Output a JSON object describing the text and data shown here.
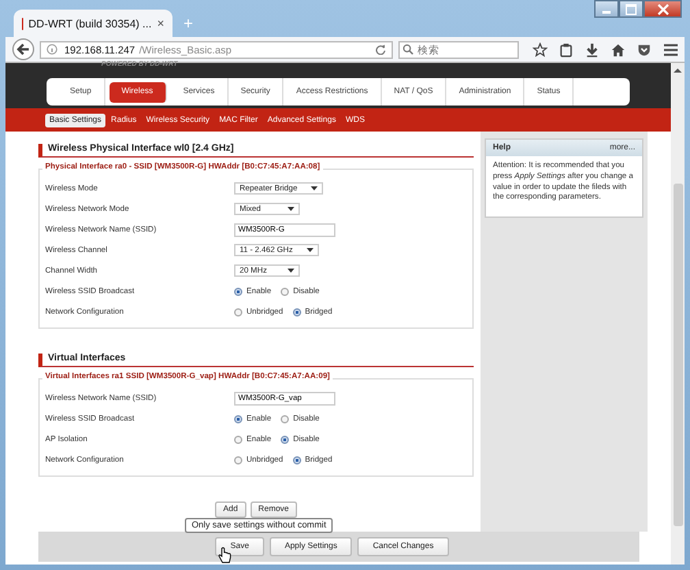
{
  "window": {
    "tab_title": "DD-WRT (build 30354) ...",
    "tab_close": "×",
    "new_tab": "+"
  },
  "address_bar": {
    "host": "192.168.11.247",
    "path": "/Wireless_Basic.asp"
  },
  "search": {
    "placeholder": "検索"
  },
  "branding": "POWERED BY DD-WRT",
  "nav": [
    {
      "label": "Setup",
      "selected": false
    },
    {
      "label": "Wireless",
      "selected": true
    },
    {
      "label": "Services",
      "selected": false
    },
    {
      "label": "Security",
      "selected": false
    },
    {
      "label": "Access Restrictions",
      "selected": false
    },
    {
      "label": "NAT / QoS",
      "selected": false
    },
    {
      "label": "Administration",
      "selected": false
    },
    {
      "label": "Status",
      "selected": false
    }
  ],
  "subnav": [
    {
      "label": "Basic Settings",
      "selected": true
    },
    {
      "label": "Radius",
      "selected": false
    },
    {
      "label": "Wireless Security",
      "selected": false
    },
    {
      "label": "MAC Filter",
      "selected": false
    },
    {
      "label": "Advanced Settings",
      "selected": false
    },
    {
      "label": "WDS",
      "selected": false
    }
  ],
  "sections": [
    {
      "title": "Wireless Physical Interface wl0 [2.4 GHz]",
      "legend": "Physical Interface ra0 - SSID [WM3500R-G] HWAddr [B0:C7:45:A7:AA:08]",
      "rows": [
        {
          "label": "Wireless Mode",
          "kind": "select",
          "value": "Repeater Bridge"
        },
        {
          "label": "Wireless Network Mode",
          "kind": "select",
          "value": "Mixed"
        },
        {
          "label": "Wireless Network Name (SSID)",
          "kind": "text",
          "value": "WM3500R-G"
        },
        {
          "label": "Wireless Channel",
          "kind": "select",
          "value": "11 - 2.462 GHz"
        },
        {
          "label": "Channel Width",
          "kind": "select",
          "value": "20 MHz"
        },
        {
          "label": "Wireless SSID Broadcast",
          "kind": "radio",
          "options": [
            {
              "label": "Enable",
              "selected": true
            },
            {
              "label": "Disable",
              "selected": false
            }
          ]
        },
        {
          "label": "Network Configuration",
          "kind": "radio",
          "options": [
            {
              "label": "Unbridged",
              "selected": false
            },
            {
              "label": "Bridged",
              "selected": true
            }
          ]
        }
      ]
    },
    {
      "title": "Virtual Interfaces",
      "legend": "Virtual Interfaces ra1 SSID [WM3500R-G_vap] HWAddr [B0:C7:45:A7:AA:09]",
      "rows": [
        {
          "label": "Wireless Network Name (SSID)",
          "kind": "text",
          "value": "WM3500R-G_vap"
        },
        {
          "label": "Wireless SSID Broadcast",
          "kind": "radio",
          "options": [
            {
              "label": "Enable",
              "selected": true
            },
            {
              "label": "Disable",
              "selected": false
            }
          ]
        },
        {
          "label": "AP Isolation",
          "kind": "radio",
          "options": [
            {
              "label": "Enable",
              "selected": false
            },
            {
              "label": "Disable",
              "selected": true
            }
          ]
        },
        {
          "label": "Network Configuration",
          "kind": "radio",
          "options": [
            {
              "label": "Unbridged",
              "selected": false
            },
            {
              "label": "Bridged",
              "selected": true
            }
          ]
        }
      ]
    }
  ],
  "interface_buttons": [
    "Add",
    "Remove"
  ],
  "tooltip": "Only save settings without commit",
  "footer_buttons": [
    "Save",
    "Apply Settings",
    "Cancel Changes"
  ],
  "help": {
    "title": "Help",
    "more": "more...",
    "text": "Attention: It is recommended that you press *Apply Settings* after you change a value in order to update the fileds with the corresponding parameters."
  }
}
